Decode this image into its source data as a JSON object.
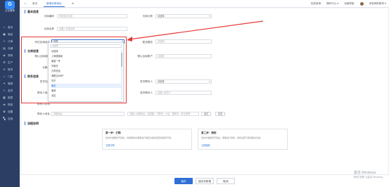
{
  "app": {
    "logo_letter": "G",
    "logo_name": "云仓管家"
  },
  "sidebar": {
    "items": [
      {
        "label": "首页",
        "icon": "home-icon"
      },
      {
        "label": "商品",
        "icon": "goods-icon"
      },
      {
        "label": "订单",
        "icon": "order-icon"
      },
      {
        "label": "仓储",
        "icon": "warehouse-icon"
      },
      {
        "label": "采购",
        "icon": "purchase-icon"
      },
      {
        "label": "生产",
        "icon": "production-icon"
      },
      {
        "label": "财务",
        "icon": "finance-icon"
      },
      {
        "label": "门店",
        "icon": "store-icon"
      },
      {
        "label": "营销",
        "icon": "marketing-icon"
      },
      {
        "label": "会员",
        "icon": "member-icon"
      },
      {
        "label": "报表",
        "icon": "report-icon"
      },
      {
        "label": "物流",
        "icon": "logistics-icon"
      },
      {
        "label": "设置",
        "icon": "settings-icon"
      },
      {
        "label": "应用",
        "icon": "apps-icon"
      }
    ]
  },
  "topbar": {
    "tabs": [
      {
        "label": "◁"
      },
      {
        "label": "首页"
      },
      {
        "label": "新增仓库地址"
      },
      {
        "label": "⊕"
      }
    ],
    "right": {
      "online": "在线咨询",
      "help": "操作中心 ▾",
      "tasks": "功能导航",
      "user": "何老师的账号 ▾"
    }
  },
  "sections": {
    "basic": "基本信息",
    "warehouse": "仓库信息",
    "contact": "联系信息",
    "flow": "流程说明"
  },
  "form": {
    "code_label": "仓库编码",
    "code_placeholder": "系统自动生成",
    "category_label": "仓库分类",
    "category_value": "请选择",
    "name_label": "仓库名称",
    "name_placeholder": "请输入仓库名称",
    "area_label": "所在区域地址",
    "area_value": "请选",
    "area_placeholder2": "请选择区域",
    "service_label": "配送服务",
    "service_placeholder": "请选择",
    "dept_label": "默认出库部门",
    "dept_placeholder": "请选择",
    "hub_label": "默认出库账户",
    "hub_placeholder": "请选择",
    "manager_label": "仓管员",
    "contact_label": "发货仓库",
    "contact_value": "请选择",
    "shipper_label": "发货联系人",
    "shipper_value": "请选择",
    "phone_label": "联系人电话",
    "phone_placeholder": "请输入联系人电话",
    "receiver_label": "收货联系人",
    "receiver_placeholder": "请输入收货人",
    "tel_label": "联系人手机",
    "addr_label": "联系人地址",
    "addr_placeholder": "详细地址",
    "addr_hint": "请输入详细地址，如道路、门牌号、小区、楼栋号、单元室等",
    "btn_locate": "定位",
    "btn_clear": "清空"
  },
  "dropdown": {
    "search_placeholder": "请选择",
    "options": [
      "请选择",
      "上海铁路局",
      "南昌一号",
      "华南仓",
      "万邦货运",
      "海盟达WMP",
      "华东",
      "南区",
      "南西",
      "北区"
    ],
    "selected_index": 7
  },
  "flow_cards": [
    {
      "title": "第一步：订购",
      "desc": "您的仓储服务开通后，将根据您的需要进行相应功能的配置和服务开通。",
      "link": "立即订购"
    },
    {
      "title": "第二步：授权",
      "desc": "您的仓储服务开通后，需要进行授权，授权后即可使用相关功能。",
      "link": "立即授权"
    }
  ],
  "footer": {
    "save": "保存",
    "save_new": "保存并新增",
    "cancel": "取消"
  },
  "watermark": {
    "line1": "激活 Windows",
    "line2": "转到\"设置\"以激活 Windows。"
  },
  "colors": {
    "accent": "#2f6fd6",
    "sidebar": "#2c3e63",
    "highlight": "#e53935"
  }
}
